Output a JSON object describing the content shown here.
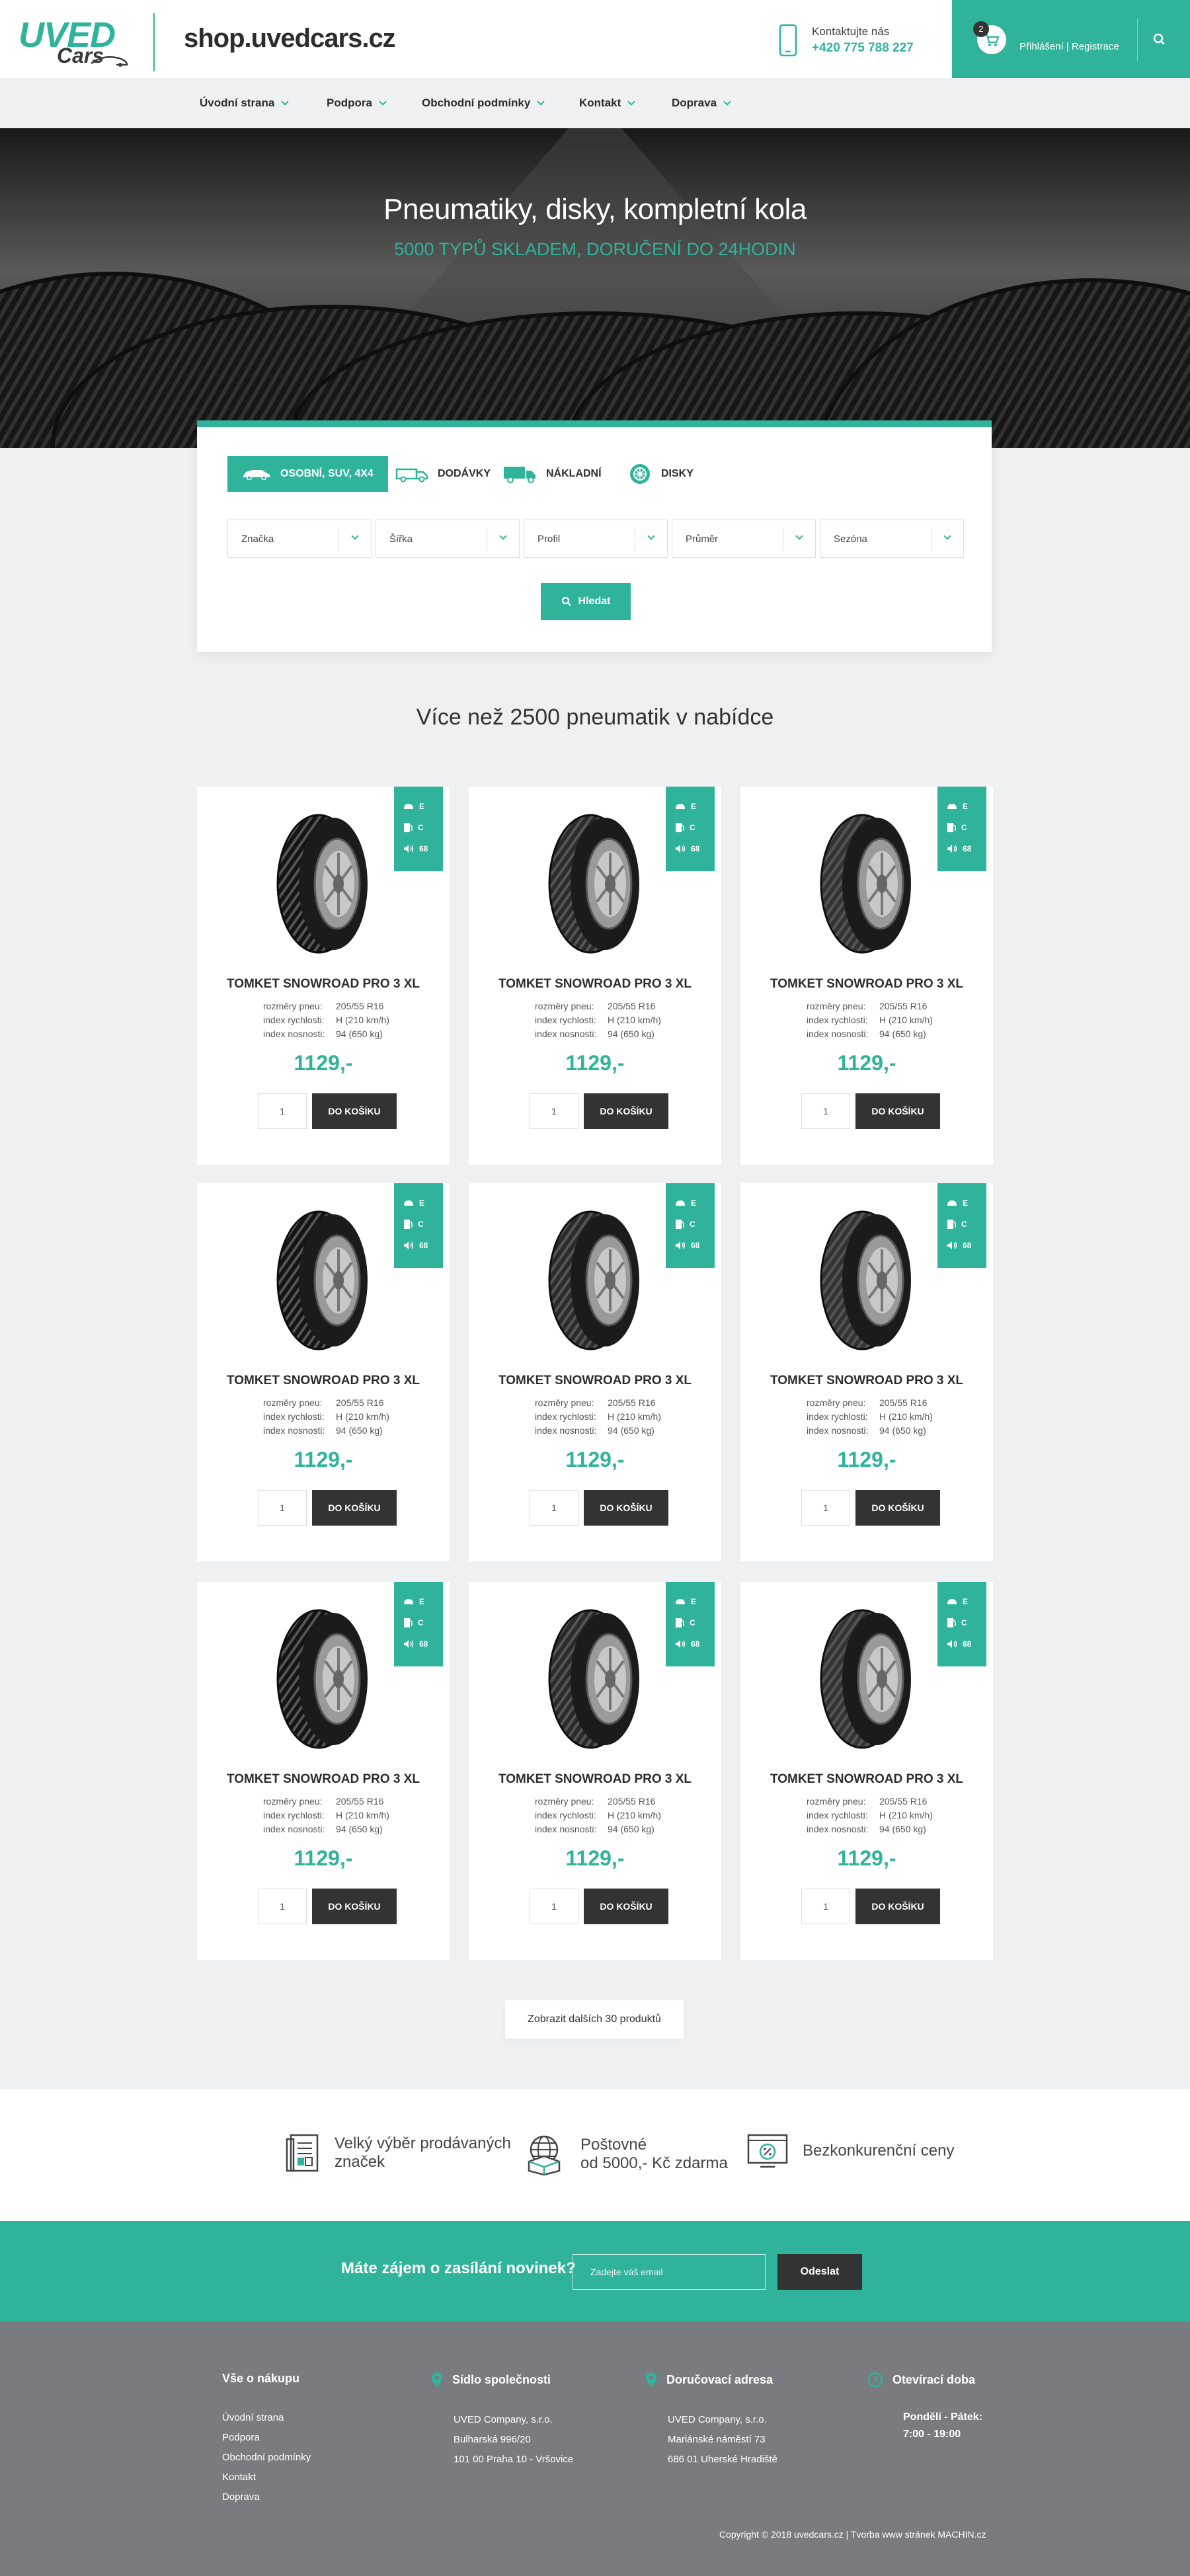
{
  "header": {
    "logo_top": "UVED",
    "logo_bottom": "Cars",
    "site_title": "shop.uvedcars.cz",
    "contact_label": "Kontaktujte nás",
    "contact_phone": "+420 775 788 227",
    "cart_count": "2",
    "account_links": "Přihlášení | Registrace"
  },
  "nav": {
    "items": [
      {
        "label": "Úvodní strana"
      },
      {
        "label": "Podpora"
      },
      {
        "label": "Obchodní podmínky"
      },
      {
        "label": "Kontakt"
      },
      {
        "label": "Doprava"
      }
    ]
  },
  "hero": {
    "title": "Pneumatiky, disky, kompletní kola",
    "subtitle": "5000 TYPŮ SKLADEM, DORUČENÍ DO 24HODIN"
  },
  "search": {
    "tabs": [
      {
        "label": "OSOBNÍ, SUV, 4X4",
        "icon": "car-icon"
      },
      {
        "label": "DODÁVKY",
        "icon": "van-icon"
      },
      {
        "label": "NÁKLADNÍ",
        "icon": "truck-icon"
      },
      {
        "label": "DISKY",
        "icon": "wheel-disk-icon"
      }
    ],
    "filters": [
      {
        "label": "Značka"
      },
      {
        "label": "Šířka"
      },
      {
        "label": "Profil"
      },
      {
        "label": "Průměr"
      },
      {
        "label": "Sezóna"
      }
    ],
    "submit_label": "Hledat"
  },
  "section_title": "Více než 2500 pneumatik v nabídce",
  "spec_labels": {
    "size": "rozměry pneu:",
    "speed": "index rychlosti:",
    "load": "index nosnosti:"
  },
  "products": [
    {
      "name": "TOMKET SNOWROAD PRO 3 XL",
      "size": "205/55 R16",
      "speed": "H (210 km/h)",
      "load": "94 (650 kg)",
      "price": "1129,-",
      "qty": "1",
      "button": "DO KOŠÍKU",
      "fuel": "E",
      "grip": "C",
      "noise": "68"
    },
    {
      "name": "TOMKET SNOWROAD PRO 3 XL",
      "size": "205/55 R16",
      "speed": "H (210 km/h)",
      "load": "94 (650 kg)",
      "price": "1129,-",
      "qty": "1",
      "button": "DO KOŠÍKU",
      "fuel": "E",
      "grip": "C",
      "noise": "68"
    },
    {
      "name": "TOMKET SNOWROAD PRO 3 XL",
      "size": "205/55 R16",
      "speed": "H (210 km/h)",
      "load": "94 (650 kg)",
      "price": "1129,-",
      "qty": "1",
      "button": "DO KOŠÍKU",
      "fuel": "E",
      "grip": "C",
      "noise": "68"
    },
    {
      "name": "TOMKET SNOWROAD PRO 3 XL",
      "size": "205/55 R16",
      "speed": "H (210 km/h)",
      "load": "94 (650 kg)",
      "price": "1129,-",
      "qty": "1",
      "button": "DO KOŠÍKU",
      "fuel": "E",
      "grip": "C",
      "noise": "68"
    },
    {
      "name": "TOMKET SNOWROAD PRO 3 XL",
      "size": "205/55 R16",
      "speed": "H (210 km/h)",
      "load": "94 (650 kg)",
      "price": "1129,-",
      "qty": "1",
      "button": "DO KOŠÍKU",
      "fuel": "E",
      "grip": "C",
      "noise": "68"
    },
    {
      "name": "TOMKET SNOWROAD PRO 3 XL",
      "size": "205/55 R16",
      "speed": "H (210 km/h)",
      "load": "94 (650 kg)",
      "price": "1129,-",
      "qty": "1",
      "button": "DO KOŠÍKU",
      "fuel": "E",
      "grip": "C",
      "noise": "68"
    },
    {
      "name": "TOMKET SNOWROAD PRO 3 XL",
      "size": "205/55 R16",
      "speed": "H (210 km/h)",
      "load": "94 (650 kg)",
      "price": "1129,-",
      "qty": "1",
      "button": "DO KOŠÍKU",
      "fuel": "E",
      "grip": "C",
      "noise": "68"
    },
    {
      "name": "TOMKET SNOWROAD PRO 3 XL",
      "size": "205/55 R16",
      "speed": "H (210 km/h)",
      "load": "94 (650 kg)",
      "price": "1129,-",
      "qty": "1",
      "button": "DO KOŠÍKU",
      "fuel": "E",
      "grip": "C",
      "noise": "68"
    },
    {
      "name": "TOMKET SNOWROAD PRO 3 XL",
      "size": "205/55 R16",
      "speed": "H (210 km/h)",
      "load": "94 (650 kg)",
      "price": "1129,-",
      "qty": "1",
      "button": "DO KOŠÍKU",
      "fuel": "E",
      "grip": "C",
      "noise": "68"
    }
  ],
  "load_more_label": "Zobrazit dalších 30 produktů",
  "features": [
    {
      "line1": "Velký výběr prodávaných",
      "line2": "značek",
      "icon": "catalog-icon"
    },
    {
      "line1": "Poštovné",
      "line2": "od 5000,- Kč zdarma",
      "icon": "globe-box-icon"
    },
    {
      "line1": "Bezkonkurenční ceny",
      "line2": "",
      "icon": "discount-screen-icon"
    }
  ],
  "newsletter": {
    "label": "Máte zájem o zasílání novinek?",
    "placeholder": "Zadejte váš email",
    "button": "Odeslat"
  },
  "footer": {
    "col1": {
      "title": "Vše o nákupu",
      "links": [
        "Úvodní strana",
        "Podpora",
        "Obchodní podmínky",
        "Kontakt",
        "Doprava"
      ]
    },
    "col2": {
      "title": "Sídlo společnosti",
      "lines": [
        "UVED Company, s.r.o.",
        "Bulharská 996/20",
        "101 00 Praha 10 - Vršovice"
      ]
    },
    "col3": {
      "title": "Doručovací adresa",
      "lines": [
        "UVED Company, s.r.o.",
        "Mariánské náměstí 73",
        "686 01 Uherské Hradiště"
      ]
    },
    "col4": {
      "title": "Otevírací doba",
      "days": "Pondělí - Pátek:",
      "hours": "7:00 - 19:00"
    },
    "copyright": "Copyright © 2018 uvedcars.cz | Tvorba www stránek MACHIN.cz"
  },
  "colors": {
    "accent": "#2fb39b",
    "dark": "#333333",
    "footer_bg": "#7a7b80",
    "page_bg": "#eff0f2"
  }
}
